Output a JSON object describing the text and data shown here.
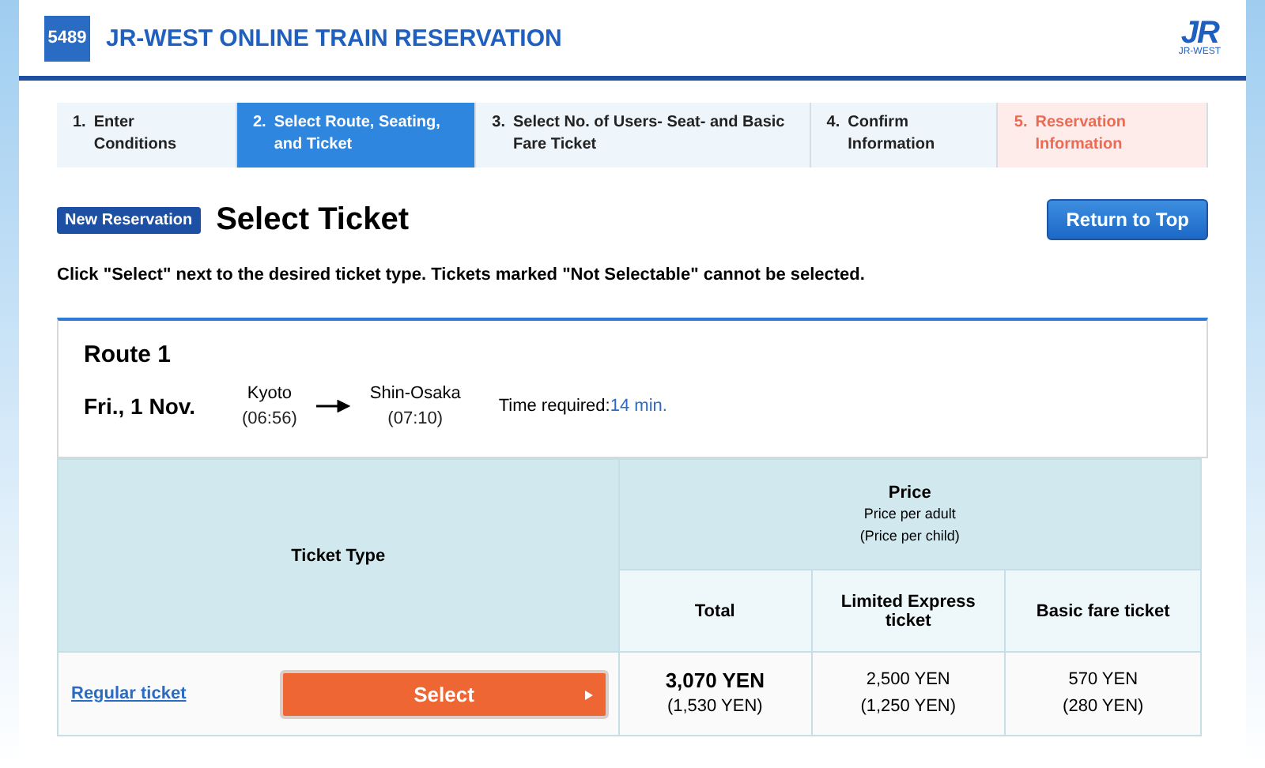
{
  "header": {
    "logo_number": "5489",
    "title": "JR-WEST ONLINE TRAIN RESERVATION",
    "brand_logo": "JR",
    "brand_caption": "JR-WEST"
  },
  "steps": [
    {
      "number": "1.",
      "label": "Enter Conditions",
      "selected": false,
      "kind": "normal"
    },
    {
      "number": "2.",
      "label": "Select Route, Seating, and Ticket",
      "selected": true,
      "kind": "normal"
    },
    {
      "number": "3.",
      "label": "Select No. of Users- Seat- and Basic Fare Ticket",
      "selected": false,
      "kind": "normal"
    },
    {
      "number": "4.",
      "label": "Confirm Information",
      "selected": false,
      "kind": "normal"
    },
    {
      "number": "5.",
      "label": "Reservation Information",
      "selected": false,
      "kind": "final"
    }
  ],
  "badge": "New Reservation",
  "page_title": "Select Ticket",
  "return_button": "Return to Top",
  "instruction": "Click \"Select\" next to the desired ticket type. Tickets marked \"Not Selectable\" cannot be selected.",
  "route": {
    "title": "Route 1",
    "date": "Fri., 1 Nov.",
    "from": {
      "station": "Kyoto",
      "time": "(06:56)"
    },
    "to": {
      "station": "Shin-Osaka",
      "time": "(07:10)"
    },
    "time_label": "Time required:",
    "time_value": "14 min."
  },
  "table": {
    "ticket_type_header": "Ticket Type",
    "price_header": "Price",
    "price_note_adult": "Price per adult",
    "price_note_child": "(Price per child)",
    "columns": [
      "Total",
      "Limited Express ticket",
      "Basic fare ticket"
    ],
    "rows": [
      {
        "ticket": "Regular ticket",
        "button": "Select",
        "prices": [
          {
            "adult": "3,070 YEN",
            "child": "(1,530 YEN)"
          },
          {
            "adult": "2,500 YEN",
            "child": "(1,250 YEN)"
          },
          {
            "adult": "570 YEN",
            "child": "(280 YEN)"
          }
        ]
      }
    ]
  }
}
